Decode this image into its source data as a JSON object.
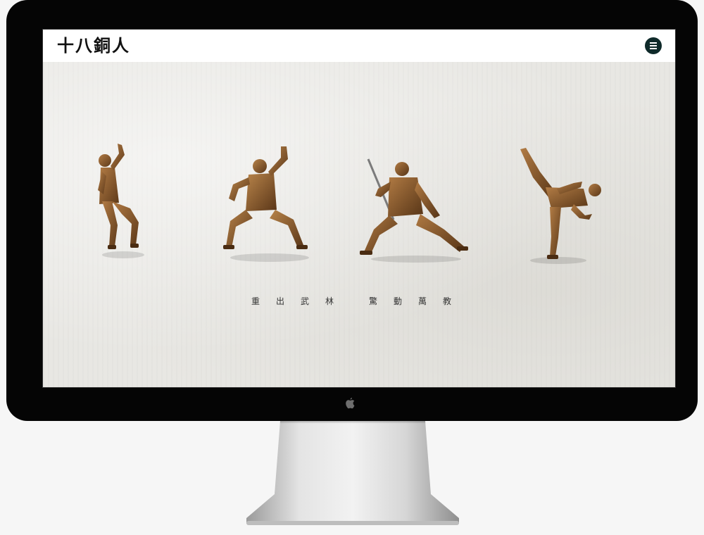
{
  "site": {
    "logo_text": "十八銅人",
    "menu_icon": "hamburger-menu-icon"
  },
  "hero": {
    "tagline_left": [
      "重",
      "出",
      "武",
      "林"
    ],
    "tagline_right": [
      "驚",
      "動",
      "萬",
      "教"
    ],
    "figures": [
      "bronze-statue-raised-fist",
      "bronze-statue-horse-stance",
      "bronze-statue-sword",
      "bronze-statue-high-kick"
    ]
  },
  "colors": {
    "bronze": "#8a5a2b",
    "menu_button": "#0f2a2a",
    "background": "#e8e7e3"
  }
}
